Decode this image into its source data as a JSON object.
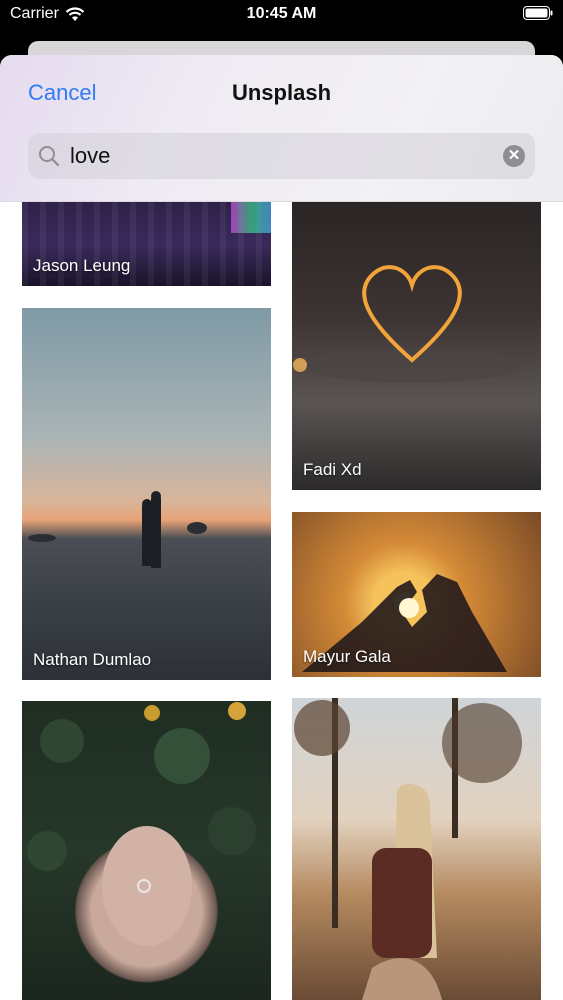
{
  "status_bar": {
    "carrier": "Carrier",
    "time": "10:45 AM"
  },
  "header": {
    "cancel_label": "Cancel",
    "title": "Unsplash",
    "search": {
      "value": "love"
    }
  },
  "photos": [
    {
      "credit": "Jason Leung"
    },
    {
      "credit": "Fadi Xd"
    },
    {
      "credit": "Nathan Dumlao"
    },
    {
      "credit": "Mayur Gala"
    },
    {
      "credit": ""
    },
    {
      "credit": ""
    }
  ],
  "colors": {
    "accent": "#2F7CF6"
  }
}
